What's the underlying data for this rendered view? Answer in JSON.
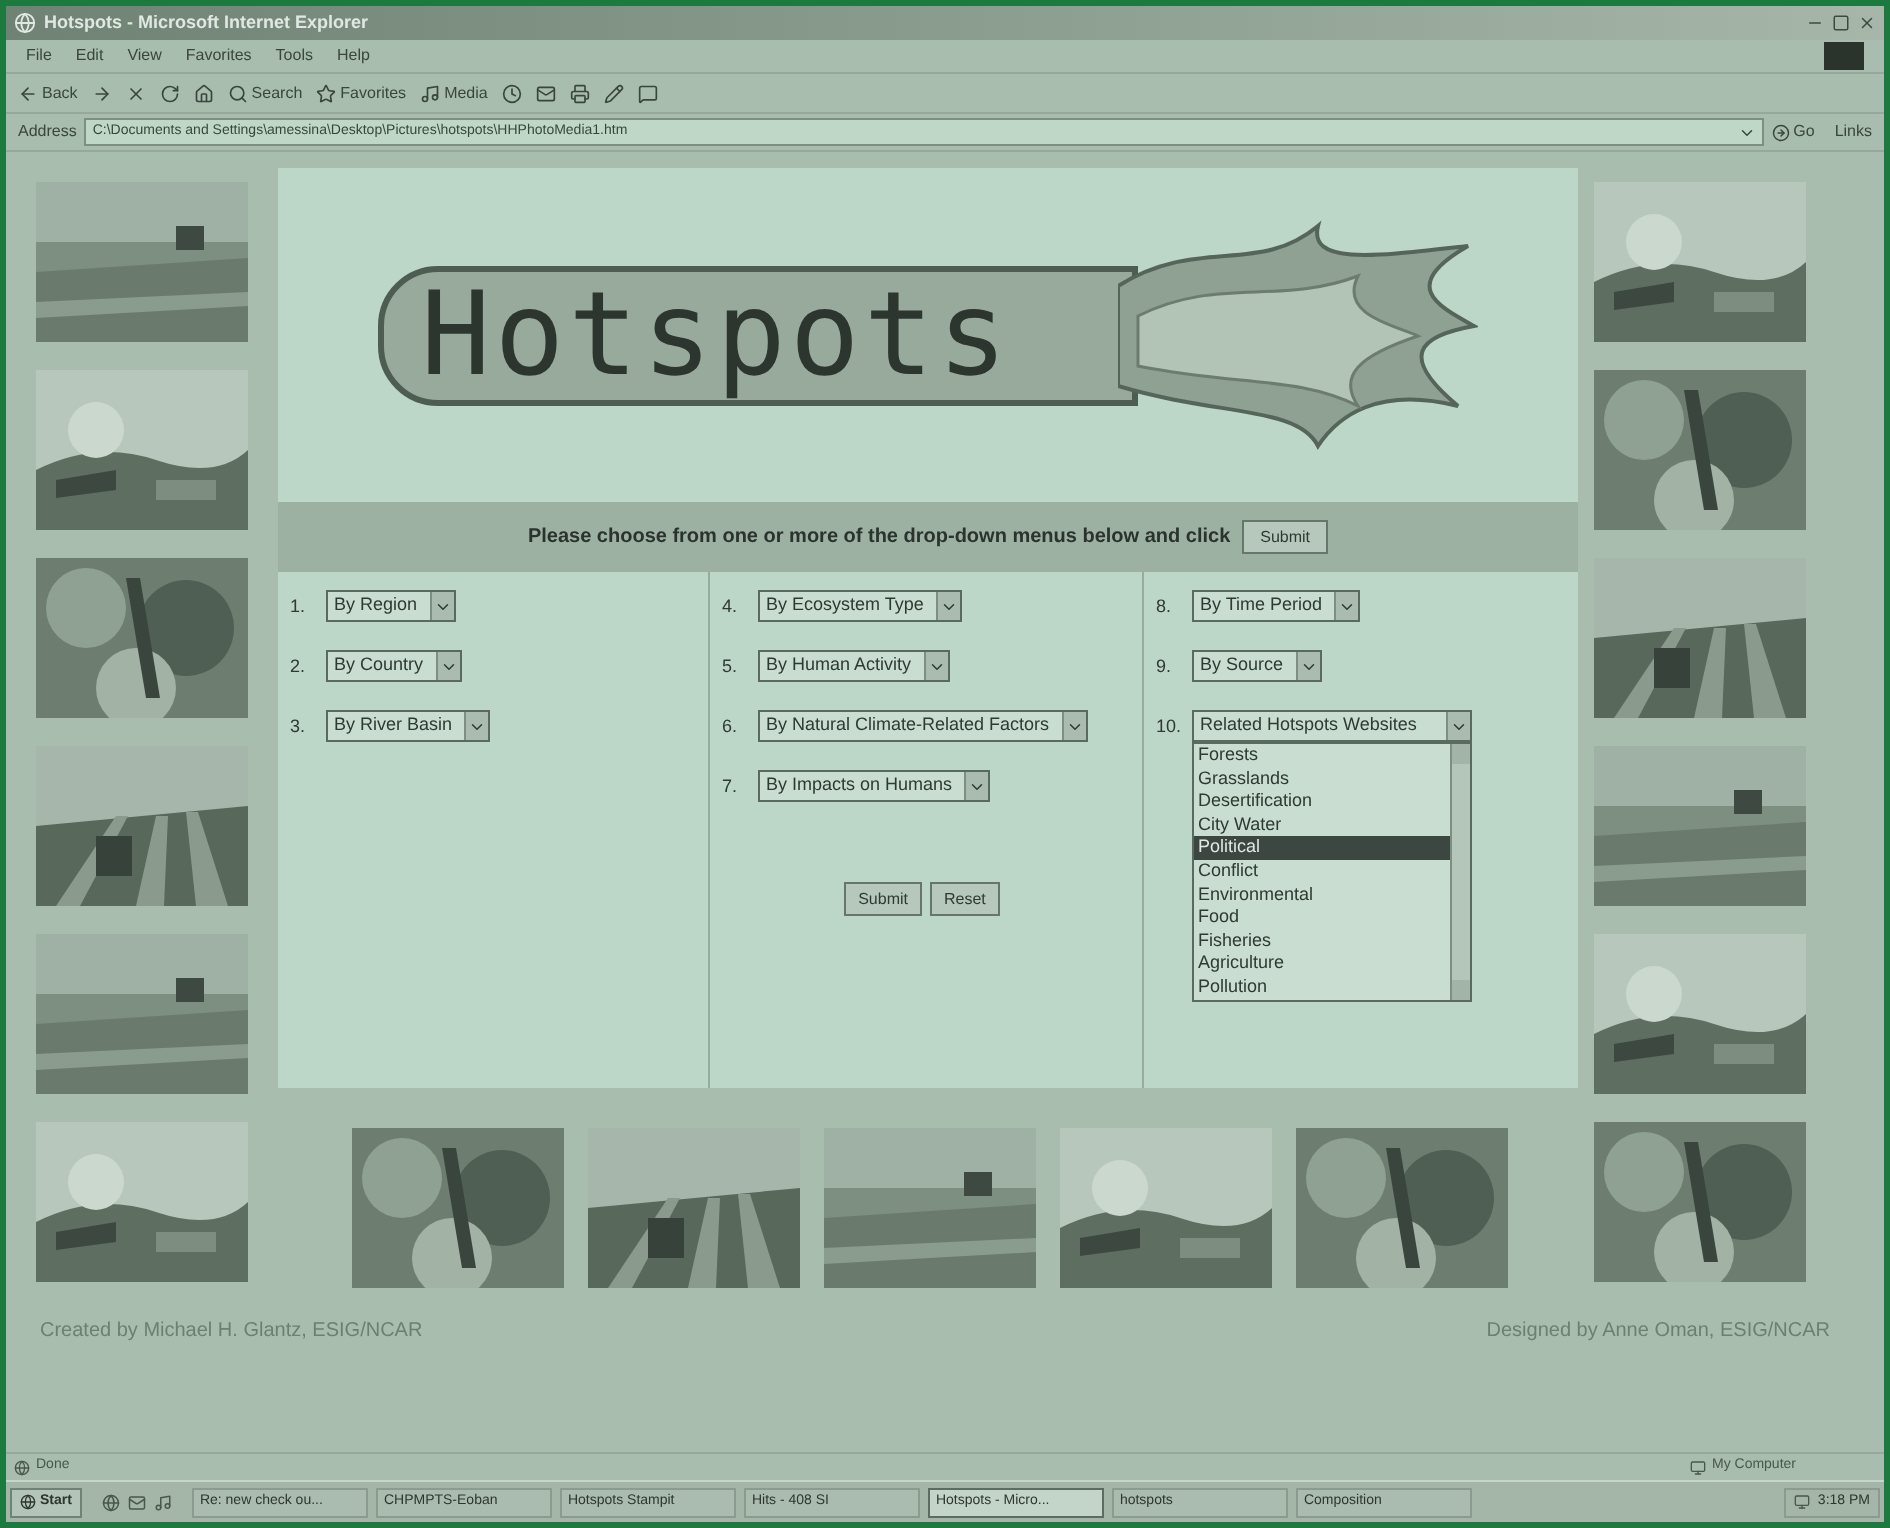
{
  "window": {
    "title": "Hotspots - Microsoft Internet Explorer"
  },
  "menu": [
    "File",
    "Edit",
    "View",
    "Favorites",
    "Tools",
    "Help"
  ],
  "toolbar": [
    {
      "kind": "back",
      "label": "Back"
    },
    {
      "kind": "forward"
    },
    {
      "kind": "stop"
    },
    {
      "kind": "refresh"
    },
    {
      "kind": "home"
    },
    {
      "kind": "search",
      "label": "Search"
    },
    {
      "kind": "favorites",
      "label": "Favorites"
    },
    {
      "kind": "media",
      "label": "Media"
    },
    {
      "kind": "history"
    },
    {
      "kind": "mail"
    },
    {
      "kind": "print"
    },
    {
      "kind": "edit"
    },
    {
      "kind": "discuss"
    }
  ],
  "address": {
    "label": "Address",
    "value": "C:\\Documents and Settings\\amessina\\Desktop\\Pictures\\hotspots\\HHPhotoMedia1.htm",
    "go": "Go",
    "links": "Links"
  },
  "page": {
    "logo": "Hotspots",
    "prompt": "Please choose from one or more of the drop-down menus below and click",
    "prompt_button": "Submit",
    "columns": [
      [
        {
          "number": "1.",
          "label": "By Region",
          "expanded": false
        },
        {
          "number": "2.",
          "label": "By Country",
          "expanded": false
        },
        {
          "number": "3.",
          "label": "By River Basin",
          "expanded": false
        }
      ],
      [
        {
          "number": "4.",
          "label": "By Ecosystem Type",
          "expanded": false
        },
        {
          "number": "5.",
          "label": "By Human Activity",
          "expanded": false
        },
        {
          "number": "6.",
          "label": "By Natural Climate-Related Factors",
          "expanded": false
        },
        {
          "number": "7.",
          "label": "By Impacts on Humans",
          "expanded": false
        }
      ],
      [
        {
          "number": "8.",
          "label": "By Time Period",
          "expanded": false
        },
        {
          "number": "9.",
          "label": "By Source",
          "expanded": false
        },
        {
          "number": "10.",
          "label": "Related Hotspots Websites",
          "expanded": true,
          "options": [
            {
              "label": "Forests",
              "selected": false
            },
            {
              "label": "Grasslands",
              "selected": false
            },
            {
              "label": "Desertification",
              "selected": false
            },
            {
              "label": "City Water",
              "selected": false
            },
            {
              "label": "Political",
              "selected": true
            },
            {
              "label": "Conflict",
              "selected": false
            },
            {
              "label": "Environmental",
              "selected": false
            },
            {
              "label": "Food",
              "selected": false
            },
            {
              "label": "Fisheries",
              "selected": false
            },
            {
              "label": "Agriculture",
              "selected": false
            },
            {
              "label": "Pollution",
              "selected": false
            }
          ]
        }
      ]
    ],
    "buttons": [
      "Submit",
      "Reset"
    ],
    "footer_left": "Created by Michael H. Glantz, ESIG/NCAR",
    "footer_right": "Designed by Anne Oman, ESIG/NCAR"
  },
  "status": {
    "text": "Done",
    "zone": "My Computer"
  },
  "taskbar": {
    "start": "Start",
    "tasks": [
      {
        "label": "Re: new check ou...",
        "selected": false
      },
      {
        "label": "CHPMPTS-Eoban",
        "selected": false
      },
      {
        "label": "Hotspots Stampit",
        "selected": false
      },
      {
        "label": "Hits - 408 SI",
        "selected": false
      },
      {
        "label": "Hotspots - Micro...",
        "selected": true
      },
      {
        "label": "hotspots",
        "selected": false
      },
      {
        "label": "Composition",
        "selected": false
      }
    ],
    "clock": "3:18 PM"
  }
}
